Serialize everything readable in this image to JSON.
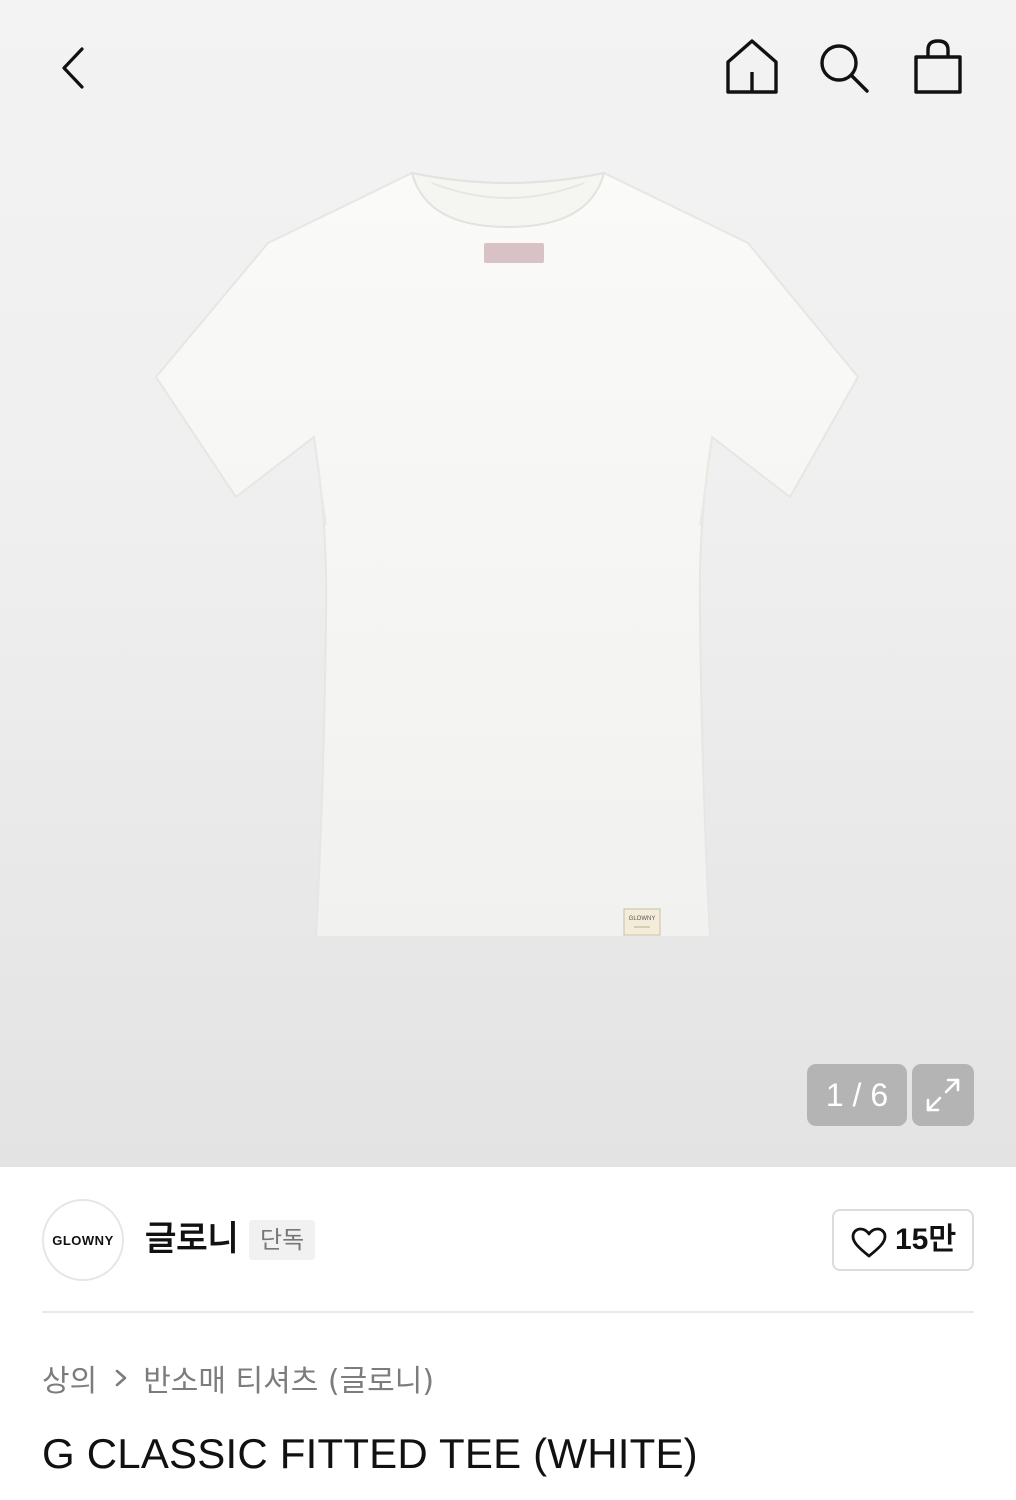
{
  "topbar": {
    "back_icon": "chevron-left-icon",
    "home_icon": "home-icon",
    "search_icon": "search-icon",
    "cart_icon": "shopping-bag-icon"
  },
  "gallery": {
    "counter": "1 / 6",
    "expand_icon": "expand-icon",
    "tag_text": "GLOWNY"
  },
  "brand": {
    "logo_text": "GLOWNY",
    "name": "글로니",
    "badge": "단독",
    "like_icon": "heart-icon",
    "like_count": "15만"
  },
  "breadcrumb": {
    "category": "상의",
    "separator_icon": "chevron-right-icon",
    "subcategory": "반소매 티셔츠 (글로니)"
  },
  "product": {
    "title": "G CLASSIC FITTED TEE (WHITE)"
  },
  "colors": {
    "background": "#ffffff",
    "hero_background": "#efefef",
    "text_primary": "#111111",
    "text_secondary": "#7c7c7c",
    "overlay_gray": "#9a9a9a"
  }
}
